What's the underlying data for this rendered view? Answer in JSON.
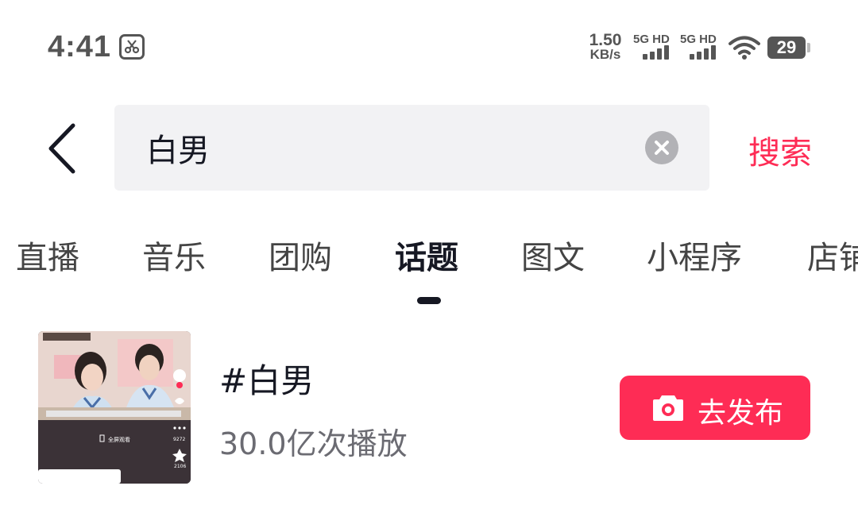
{
  "status_bar": {
    "time": "4:41",
    "net_speed_value": "1.50",
    "net_speed_unit": "KB/s",
    "sim1_label": "5G HD",
    "sim2_label": "5G HD",
    "battery_level": "29",
    "app_icon": "scissors-icon"
  },
  "search": {
    "query": "白男",
    "placeholder": "",
    "submit_label": "搜索",
    "back_icon": "back-arrow-icon",
    "clear_icon": "clear-icon"
  },
  "tabs": [
    {
      "label": "直播",
      "active": false
    },
    {
      "label": "音乐",
      "active": false
    },
    {
      "label": "团购",
      "active": false
    },
    {
      "label": "话题",
      "active": true
    },
    {
      "label": "图文",
      "active": false
    },
    {
      "label": "小程序",
      "active": false
    },
    {
      "label": "店铺",
      "active": false
    }
  ],
  "topic": {
    "title": "#白男",
    "stats": "30.0亿次播放",
    "publish_label": "去发布",
    "publish_icon": "camera-icon",
    "thumbnail": {
      "overlay_text": "全屏观看",
      "like_count": "9272",
      "favorite_count": "2106"
    }
  },
  "colors": {
    "accent": "#fe2c55",
    "text_primary": "#161823",
    "text_secondary": "#6b6b72",
    "search_bg": "#f2f2f4"
  }
}
